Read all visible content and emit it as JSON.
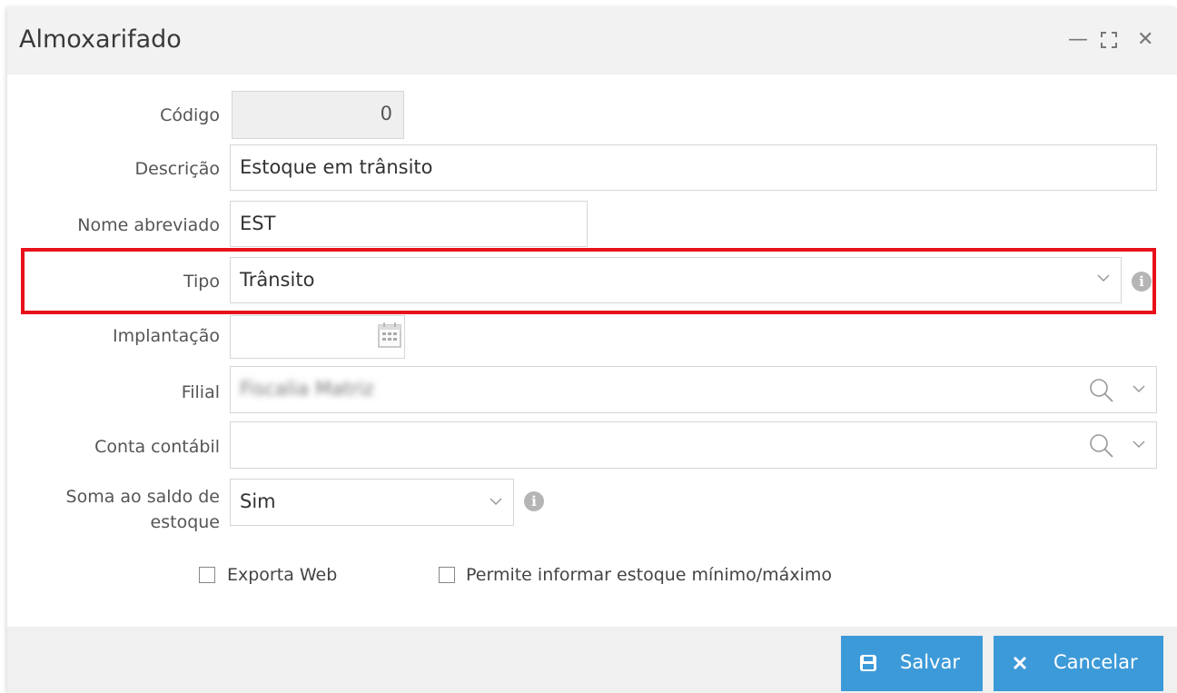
{
  "dialog": {
    "title": "Almoxarifado"
  },
  "window_controls": {
    "minimize": "—",
    "maximize": "⛶",
    "close": "✕"
  },
  "fields": {
    "codigo": {
      "label": "Código",
      "value": "0"
    },
    "descricao": {
      "label": "Descrição",
      "value": "Estoque em trânsito"
    },
    "nome_abreviado": {
      "label": "Nome abreviado",
      "value": "EST"
    },
    "tipo": {
      "label": "Tipo",
      "value": "Trânsito"
    },
    "implantacao": {
      "label": "Implantação",
      "value": ""
    },
    "filial": {
      "label": "Filial",
      "value": "Fiscalia Matriz"
    },
    "conta_contabil": {
      "label": "Conta contábil",
      "value": ""
    },
    "soma_saldo": {
      "label_line1": "Soma ao saldo de",
      "label_line2": "estoque",
      "value": "Sim"
    }
  },
  "checkboxes": {
    "exporta_web": {
      "label": "Exporta Web",
      "checked": false
    },
    "permite_estoque": {
      "label": "Permite informar estoque mínimo/máximo",
      "checked": false
    }
  },
  "buttons": {
    "salvar": "Salvar",
    "cancelar": "Cancelar"
  },
  "icons": {
    "info": "info-icon",
    "search": "search-icon",
    "calendar": "calendar-icon",
    "save": "floppy-icon",
    "cancel": "close-icon"
  },
  "colors": {
    "primary_button": "#3d9ad8",
    "highlight": "#e8101a"
  }
}
